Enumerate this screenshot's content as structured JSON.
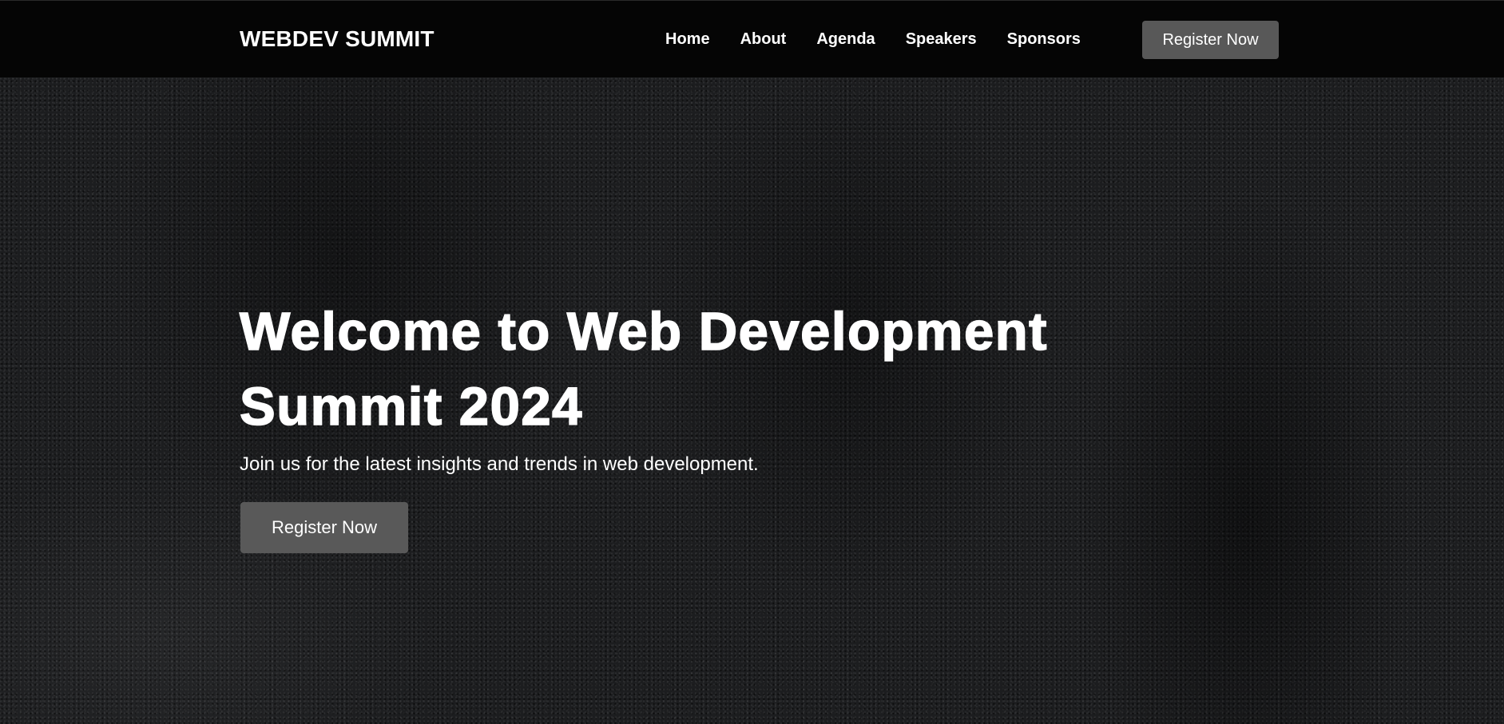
{
  "navbar": {
    "brand": "WEBDEV SUMMIT",
    "links": [
      "Home",
      "About",
      "Agenda",
      "Speakers",
      "Sponsors"
    ],
    "cta_label": "Register Now"
  },
  "hero": {
    "title": "Welcome to Web Development Summit 2024",
    "subtitle": "Join us for the latest insights and trends in web development.",
    "cta_label": "Register Now"
  },
  "colors": {
    "navbar_bg": "#050505",
    "button_bg": "#585858",
    "hero_bg": "#1c1d1f",
    "text": "#ffffff"
  }
}
